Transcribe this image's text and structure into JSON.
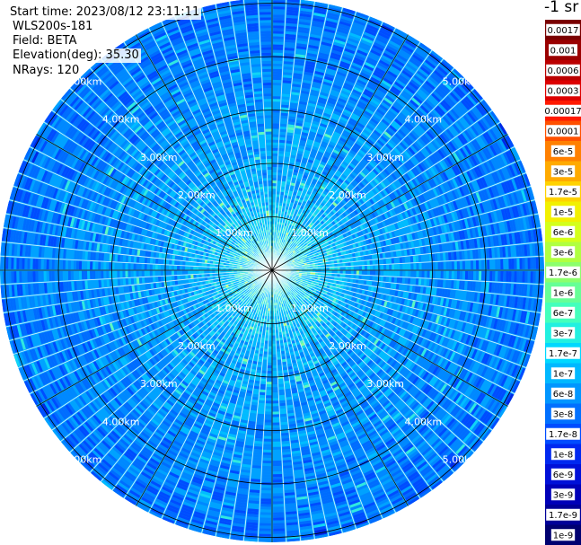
{
  "info": {
    "start_time": "Start time: 2023/08/12 23:11:11",
    "instrument": "WLS200s-181",
    "field": "Field: BETA",
    "elevation": "Elevation(deg): 35.30",
    "nrays": "NRays: 120"
  },
  "colorbar": {
    "units": "-1 sr",
    "labels": [
      "0.0017",
      "0.001",
      "0.0006",
      "0.0003",
      "0.00017",
      "0.0001",
      "6e-5",
      "3e-5",
      "1.7e-5",
      "1e-5",
      "6e-6",
      "3e-6",
      "1.7e-6",
      "1e-6",
      "6e-7",
      "3e-7",
      "1.7e-7",
      "1e-7",
      "6e-8",
      "3e-8",
      "1.7e-8",
      "1e-8",
      "6e-9",
      "3e-9",
      "1.7e-9",
      "1e-9"
    ],
    "colors": [
      "#7a0000",
      "#9a0000",
      "#bb0000",
      "#dd0000",
      "#ff1a00",
      "#ff5000",
      "#ff8000",
      "#ffaa00",
      "#ffd200",
      "#f2f000",
      "#d4ff1a",
      "#b0ff40",
      "#8cff6c",
      "#66ff96",
      "#44ffbc",
      "#22f0e0",
      "#00d8ff",
      "#00b8ff",
      "#0096ff",
      "#0070ff",
      "#004cff",
      "#0028f0",
      "#0010d8",
      "#0000b8",
      "#000098",
      "#000070"
    ]
  },
  "chart_data": {
    "type": "heatmap",
    "title": "",
    "projection": "polar PPI scan",
    "field": "BETA",
    "rays": 120,
    "range_rings_km": [
      1,
      2,
      3,
      4,
      5
    ],
    "ring_labels": [
      "1.00km",
      "2.00km",
      "3.00km",
      "4.00km",
      "5.00km"
    ],
    "spokes_deg": [
      0,
      30,
      60,
      90,
      120,
      150,
      180,
      210,
      240,
      270,
      300,
      330
    ],
    "color_scale": "log",
    "color_range": [
      1e-09,
      0.0017
    ],
    "typical_value_near_center": "1e-6 to 1e-7",
    "typical_value_far_range": "1e-7 to 1e-8"
  }
}
